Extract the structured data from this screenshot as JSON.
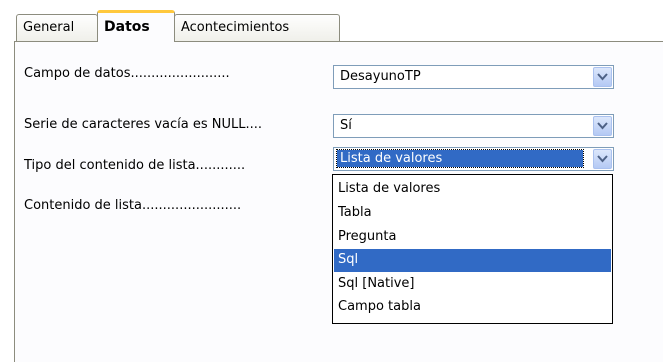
{
  "tabs": [
    {
      "label": "General",
      "active": false
    },
    {
      "label": "Datos",
      "active": true
    },
    {
      "label": "Acontecimientos",
      "active": false
    }
  ],
  "fields": [
    {
      "label": "Campo de datos........................",
      "value": "DesayunoTP"
    },
    {
      "label": "Serie de caracteres vacía es NULL....",
      "value": "Sí"
    },
    {
      "label": "Tipo del contenido de lista............",
      "value": "Lista de valores"
    },
    {
      "label": "Contenido de lista........................"
    }
  ],
  "dropdown": {
    "options": [
      "Lista de valores",
      "Tabla",
      "Pregunta",
      "Sql",
      "Sql [Native]",
      "Campo tabla"
    ],
    "selected": "Sql"
  },
  "icons": {
    "combo_button": "chevron-down-icon"
  },
  "colors": {
    "highlight": "#316ac5",
    "active_tab_accent": "#ffc83c",
    "combo_border": "#7f9db9"
  }
}
